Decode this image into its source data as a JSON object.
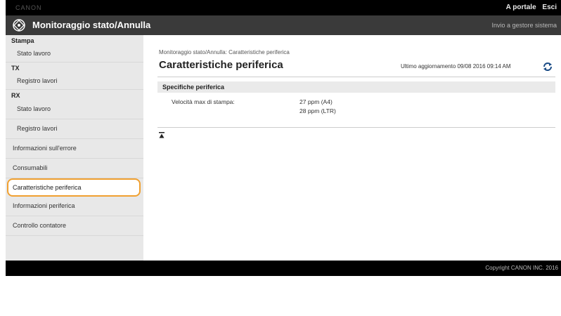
{
  "topbar": {
    "blurred_text": "CANON",
    "portal_label": "A portale",
    "logout_label": "Esci"
  },
  "header": {
    "title": "Monitoraggio stato/Annulla",
    "start_link": "Invio a gestore sistema"
  },
  "sidebar": {
    "sections": [
      {
        "heading": "Stampa",
        "items": [
          "Stato lavoro"
        ]
      },
      {
        "heading": "TX",
        "items": [
          "Registro lavori"
        ]
      },
      {
        "heading": "RX",
        "items": [
          "Stato lavoro",
          "Registro lavori"
        ]
      }
    ],
    "extra_items": [
      "Informazioni sull'errore",
      "Consumabili",
      "Caratteristiche periferica",
      "Informazioni periferica",
      "Controllo contatore"
    ],
    "selected": "Caratteristiche periferica"
  },
  "main": {
    "breadcrumb": "Monitoraggio stato/Annulla: Caratteristiche periferica",
    "title": "Caratteristiche periferica",
    "last_update": "Ultimo aggiornamento 09/08 2016 09:14 AM",
    "section_title": "Specifiche periferica",
    "spec_label": "Velocità max di stampa:",
    "spec_values": [
      "27 ppm (A4)",
      "28 ppm (LTR)"
    ]
  },
  "footer": {
    "copyright": "Copyright CANON INC. 2016"
  },
  "colors": {
    "highlight": "#f0a030",
    "topbar": "#000000",
    "titlebar": "#3a3a3a",
    "sidebar": "#e8e8e8"
  },
  "icons": {
    "logo": "printer-logo-icon",
    "refresh": "refresh-icon",
    "top": "back-to-top-icon"
  }
}
